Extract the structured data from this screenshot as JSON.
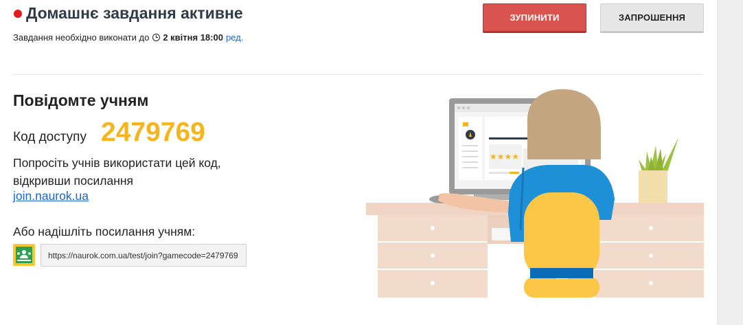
{
  "header": {
    "title": "Домашнє завдання активне",
    "deadline_prefix": "Завдання необхідно виконати до",
    "deadline_value": "2 квітня 18:00",
    "edit_label": "ред.",
    "stop_label": "Зупинити",
    "invite_label": "Запрошення",
    "status_color": "#e21b1b"
  },
  "main": {
    "section_title": "Повідомте учням",
    "code_label": "Код доступу",
    "code_value": "2479769",
    "instruction": "Попросіть учнів використати цей код, відкривши посилання",
    "join_link": "join.naurok.ua",
    "send_label": "Або надішліть посилання учням:",
    "share_url": "https://naurok.com.ua/test/join?gamecode=2479769",
    "classroom_icon": "google-classroom-icon"
  },
  "illustration": {
    "stars": "★★★★"
  },
  "colors": {
    "accent": "#f6b51d",
    "stop_button": "#d9534f",
    "link": "#1b66c9",
    "title": "#2f3b49"
  }
}
